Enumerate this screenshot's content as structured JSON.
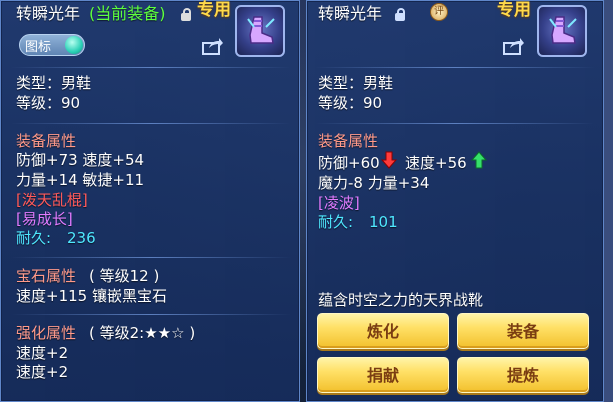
{
  "left": {
    "name": "转瞬光年",
    "current_tag": "(当前装备)",
    "exclusive": "专用",
    "badge_label": "图标",
    "type_line": "类型：男鞋",
    "level_line": "等级：90",
    "attr_title": "装备属性",
    "attr_line1": "防御+73 速度+54",
    "attr_line2": "力量+14 敏捷+11",
    "special1": "[泼天乱棍]",
    "special2": "[易成长]",
    "durability_label": "耐久:",
    "durability_value": "236",
    "gem_title": "宝石属性",
    "gem_level": "( 等级12 )",
    "gem_line": "速度+115 镶嵌黑宝石",
    "strengthen_title": "强化属性",
    "strengthen_level": "( 等级2:★★☆ )",
    "strengthen_line1": "速度+2",
    "strengthen_line2": "速度+2"
  },
  "right": {
    "name": "转瞬光年",
    "exclusive": "专用",
    "seal_char": "评",
    "type_line": "类型：男鞋",
    "level_line": "等级：90",
    "attr_title": "装备属性",
    "defense": "防御+60",
    "speed": "速度+56",
    "attr_line2": "魔力-8 力量+34",
    "special1": "[凌波]",
    "durability_label": "耐久:",
    "durability_value": "101",
    "description": "蕴含时空之力的天界战靴",
    "buttons": {
      "refine": "炼化",
      "equip": "装备",
      "donate": "捐献",
      "extract": "提炼"
    }
  },
  "colors": {
    "panel": "#203a70",
    "border": "#5f86c9",
    "section": "#ff9a8a",
    "green": "#5dff3e",
    "purple": "#e07bff",
    "cyan": "#4fe8ff",
    "gold": "#ffd94a",
    "button": "#ffe066"
  },
  "icons": [
    "lock-icon",
    "share-icon",
    "boots-icon",
    "arrow-down-icon",
    "arrow-up-icon",
    "seal-icon"
  ]
}
